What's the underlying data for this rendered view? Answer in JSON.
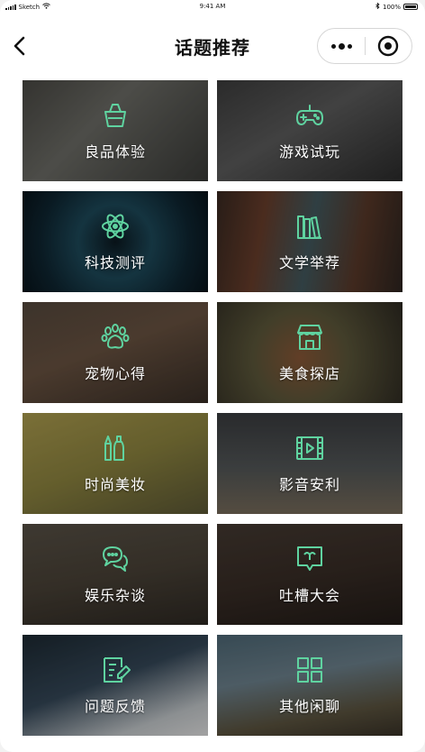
{
  "status_bar": {
    "carrier": "Sketch",
    "time": "9:41 AM",
    "battery": "100%"
  },
  "nav": {
    "title": "话题推荐"
  },
  "accent_color": "#5fd3a0",
  "topics": [
    {
      "label": "良品体验",
      "icon": "basket-icon"
    },
    {
      "label": "游戏试玩",
      "icon": "gamepad-icon"
    },
    {
      "label": "科技测评",
      "icon": "atom-icon"
    },
    {
      "label": "文学举荐",
      "icon": "books-icon"
    },
    {
      "label": "宠物心得",
      "icon": "paw-icon"
    },
    {
      "label": "美食探店",
      "icon": "storefront-icon"
    },
    {
      "label": "时尚美妆",
      "icon": "cosmetics-icon"
    },
    {
      "label": "影音安利",
      "icon": "film-icon"
    },
    {
      "label": "娱乐杂谈",
      "icon": "chat-bubbles-icon"
    },
    {
      "label": "吐槽大会",
      "icon": "message-board-icon"
    },
    {
      "label": "问题反馈",
      "icon": "feedback-icon"
    },
    {
      "label": "其他闲聊",
      "icon": "grid-icon"
    }
  ]
}
